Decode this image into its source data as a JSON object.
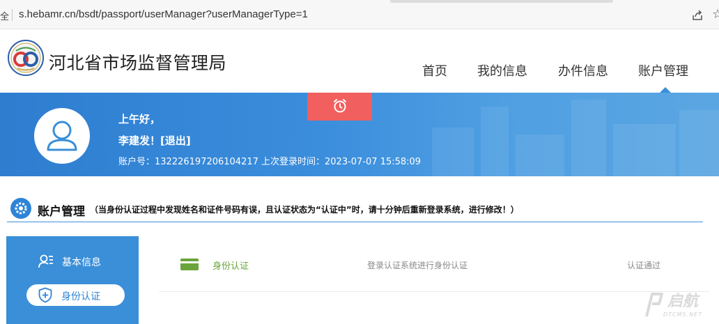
{
  "browser": {
    "security_label": "全",
    "url": "s.hebamr.cn/bsdt/passport/userManager?userManagerType=1"
  },
  "header": {
    "site_title": "河北省市场监督管理局",
    "nav": [
      "首页",
      "我的信息",
      "办件信息",
      "账户管理"
    ],
    "active_nav": "账户管理"
  },
  "banner": {
    "greeting": "上午好，",
    "user_line": "李建发！[退出]",
    "account_line": "账户号：132226197206104217 上次登录时间：2023-07-07 15:58:09"
  },
  "section": {
    "title": "账户管理",
    "note": "（当身份认证过程中发现姓名和证件号码有误，且认证状态为“认证中”时，请十分钟后重新登录系统，进行修改！）"
  },
  "sidebar": {
    "items": [
      {
        "label": "基本信息",
        "icon": "user-list-icon",
        "active": false
      },
      {
        "label": "身份认证",
        "icon": "shield-plus-icon",
        "active": true
      }
    ]
  },
  "content": {
    "rows": [
      {
        "label": "身份认证",
        "description": "登录认证系统进行身份认证",
        "status": "认证通过",
        "icon": "card-icon"
      }
    ]
  },
  "watermark": {
    "text": "启航",
    "subtext": "DTCMS.NET"
  },
  "colors": {
    "primary": "#3a8fd8",
    "alarm": "#f15f5f",
    "success_green": "#6aa43a"
  }
}
